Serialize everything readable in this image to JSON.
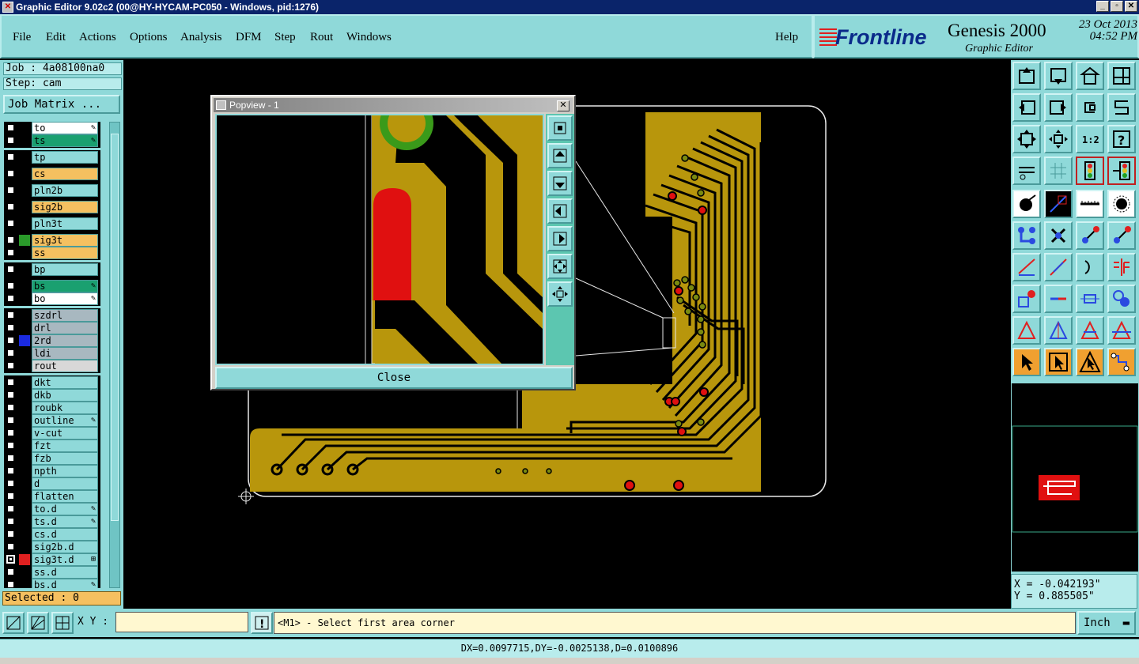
{
  "window": {
    "title": "Graphic Editor 9.02c2 (00@HY-HYCAM-PC050 - Windows, pid:1276)",
    "buttons": [
      "_",
      "▫",
      "✕"
    ]
  },
  "menu": {
    "items": [
      "File",
      "Edit",
      "Actions",
      "Options",
      "Analysis",
      "DFM",
      "Step",
      "Rout",
      "Windows"
    ],
    "help": "Help"
  },
  "brand": {
    "logo": "Frontline",
    "product": "Genesis 2000",
    "subtitle": "Graphic Editor",
    "date": "23 Oct 2013",
    "time": "04:52 PM"
  },
  "job": {
    "job_label": "Job : 4a08100na0",
    "step_label": "Step: cam",
    "matrix_button": "Job Matrix ..."
  },
  "layers": [
    {
      "name": "to",
      "color": "#ffffff",
      "swatch": "#000000",
      "mark": "✎",
      "checked": false
    },
    {
      "name": "ts",
      "color": "#1aa070",
      "swatch": "#000000",
      "mark": "✎",
      "checked": false
    },
    {
      "name": "tp",
      "color": "#8fd9d9",
      "swatch": "#000000",
      "mark": "",
      "checked": false
    },
    {
      "name": "cs",
      "color": "#f5c060",
      "swatch": "#000000",
      "mark": "",
      "checked": false
    },
    {
      "name": "pln2b",
      "color": "#8fd9d9",
      "swatch": "#000000",
      "mark": "",
      "checked": false
    },
    {
      "name": "sig2b",
      "color": "#f5c060",
      "swatch": "#000000",
      "mark": "",
      "checked": false
    },
    {
      "name": "pln3t",
      "color": "#8fd9d9",
      "swatch": "#000000",
      "mark": "",
      "checked": false
    },
    {
      "name": "sig3t",
      "color": "#f5c060",
      "swatch": "#2a9a2a",
      "mark": "",
      "checked": false
    },
    {
      "name": "ss",
      "color": "#f5c060",
      "swatch": "#000000",
      "mark": "",
      "checked": false
    },
    {
      "name": "bp",
      "color": "#8fd9d9",
      "swatch": "#000000",
      "mark": "",
      "checked": false
    },
    {
      "name": "bs",
      "color": "#1aa070",
      "swatch": "#000000",
      "mark": "✎",
      "checked": false
    },
    {
      "name": "bo",
      "color": "#ffffff",
      "swatch": "#000000",
      "mark": "✎",
      "checked": false
    },
    {
      "name": "szdrl",
      "color": "#a8b8c0",
      "swatch": "#000000",
      "mark": "",
      "checked": false
    },
    {
      "name": "drl",
      "color": "#a8b8c0",
      "swatch": "#000000",
      "mark": "",
      "checked": false
    },
    {
      "name": "2rd",
      "color": "#a8b8c0",
      "swatch": "#1a2ae0",
      "mark": "",
      "checked": false
    },
    {
      "name": "ldi",
      "color": "#a8b8c0",
      "swatch": "#000000",
      "mark": "",
      "checked": false
    },
    {
      "name": "rout",
      "color": "#d8d8d8",
      "swatch": "#000000",
      "mark": "",
      "checked": false
    },
    {
      "name": "dkt",
      "color": "#8fd9d9",
      "swatch": "#000000",
      "mark": "",
      "checked": false
    },
    {
      "name": "dkb",
      "color": "#8fd9d9",
      "swatch": "#000000",
      "mark": "",
      "checked": false
    },
    {
      "name": "roubk",
      "color": "#8fd9d9",
      "swatch": "#000000",
      "mark": "",
      "checked": false
    },
    {
      "name": "outline",
      "color": "#8fd9d9",
      "swatch": "#000000",
      "mark": "✎",
      "checked": false
    },
    {
      "name": "v-cut",
      "color": "#8fd9d9",
      "swatch": "#000000",
      "mark": "",
      "checked": false
    },
    {
      "name": "fzt",
      "color": "#8fd9d9",
      "swatch": "#000000",
      "mark": "",
      "checked": false
    },
    {
      "name": "fzb",
      "color": "#8fd9d9",
      "swatch": "#000000",
      "mark": "",
      "checked": false
    },
    {
      "name": "npth",
      "color": "#8fd9d9",
      "swatch": "#000000",
      "mark": "",
      "checked": false
    },
    {
      "name": "d",
      "color": "#8fd9d9",
      "swatch": "#000000",
      "mark": "",
      "checked": false
    },
    {
      "name": "flatten",
      "color": "#8fd9d9",
      "swatch": "#000000",
      "mark": "",
      "checked": false
    },
    {
      "name": "to.d",
      "color": "#8fd9d9",
      "swatch": "#000000",
      "mark": "✎",
      "checked": false
    },
    {
      "name": "ts.d",
      "color": "#8fd9d9",
      "swatch": "#000000",
      "mark": "✎",
      "checked": false
    },
    {
      "name": "cs.d",
      "color": "#8fd9d9",
      "swatch": "#000000",
      "mark": "",
      "checked": false
    },
    {
      "name": "sig2b.d",
      "color": "#8fd9d9",
      "swatch": "#000000",
      "mark": "",
      "checked": false
    },
    {
      "name": "sig3t.d",
      "color": "#8fd9d9",
      "swatch": "#e02020",
      "mark": "⊞",
      "checked": true
    },
    {
      "name": "ss.d",
      "color": "#8fd9d9",
      "swatch": "#000000",
      "mark": "",
      "checked": false
    },
    {
      "name": "bs.d",
      "color": "#8fd9d9",
      "swatch": "#000000",
      "mark": "✎",
      "checked": false
    }
  ],
  "selected": "Selected : 0",
  "popview": {
    "title": "Popview - 1",
    "close_label": "Close",
    "close_x": "✕"
  },
  "coords": {
    "x": "X = -0.042193\"",
    "y": "Y = 0.885505\""
  },
  "bottom": {
    "xy_label": "X Y :",
    "xy_value": "",
    "prompt_icon": "!",
    "prompt": "<M1> - Select first area corner",
    "unit": "Inch"
  },
  "status": "DX=0.0097715,DY=-0.0025138,D=0.0100896",
  "colors": {
    "copper": "#b8960c",
    "pad_red": "#e01010",
    "panel": "#8fd9d9",
    "pad_green": "#7a8a10"
  }
}
